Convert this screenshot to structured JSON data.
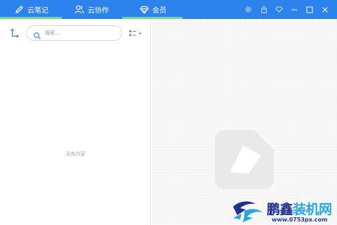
{
  "tabs": [
    {
      "label": "云笔记",
      "icon": "pen-icon",
      "active": true
    },
    {
      "label": "云协作",
      "icon": "users-icon",
      "active": false
    },
    {
      "label": "会员",
      "icon": "diamond-icon",
      "active": false
    }
  ],
  "window_controls": [
    "settings-icon",
    "lock-icon",
    "vip-diamond-icon",
    "minimize-icon",
    "maximize-icon",
    "close-icon"
  ],
  "search": {
    "placeholder": "搜索..."
  },
  "note_list": {
    "empty_text": "没有内容"
  },
  "watermark": {
    "part1": "鹏鑫",
    "part2": "装机网",
    "url": "www.0753px.com"
  },
  "colors": {
    "titlebar": "#2c83ec",
    "tab_underline": "#6fdc8c",
    "pane_bg": "#f4f4f4"
  }
}
